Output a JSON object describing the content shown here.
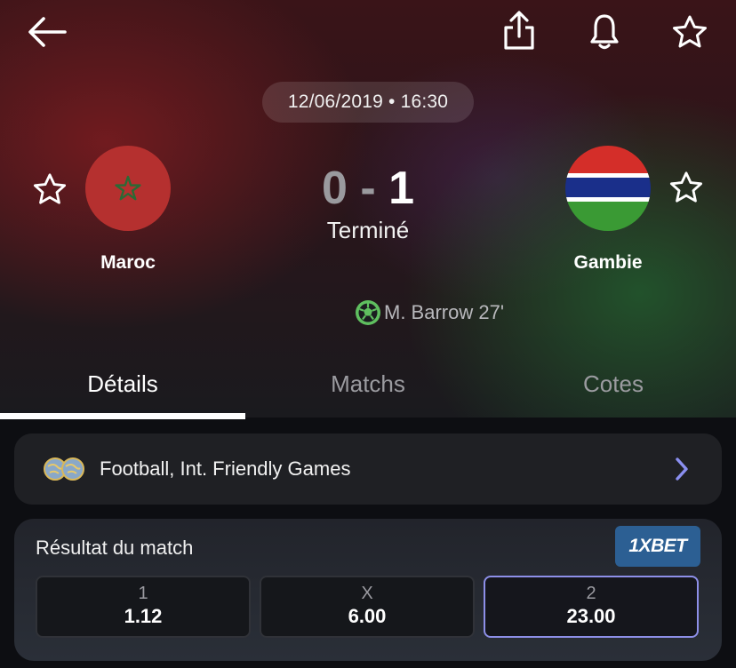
{
  "header": {
    "icons": [
      "arrow-left-icon",
      "share-icon",
      "bell-icon",
      "star-icon"
    ]
  },
  "match": {
    "datetime": "12/06/2019 • 16:30",
    "home": {
      "name": "Maroc",
      "flag": "morocco-flag",
      "flag_color": "#b5302f"
    },
    "away": {
      "name": "Gambie",
      "flag": "gambia-flag",
      "flag_colors": [
        "#d42e29",
        "#ffffff",
        "#1a2f8a",
        "#3a9a34"
      ]
    },
    "score_home": "0",
    "score_sep": "-",
    "score_away": "1",
    "status": "Terminé",
    "goals": [
      {
        "player": "M. Barrow 27'",
        "icon": "football-icon",
        "icon_color": "#5fbf5f"
      }
    ]
  },
  "tabs": [
    {
      "label": "Détails",
      "active": true
    },
    {
      "label": "Matchs",
      "active": false
    },
    {
      "label": "Cotes",
      "active": false
    }
  ],
  "league": {
    "name": "Football, Int. Friendly Games",
    "icon": "globe-icon",
    "chevron_color": "#8a8ff0"
  },
  "odds": {
    "title": "Résultat du match",
    "bookmaker": "1XBET",
    "bookmaker_color": "#2c5f93",
    "options": [
      {
        "label": "1",
        "value": "1.12",
        "selected": false
      },
      {
        "label": "X",
        "value": "6.00",
        "selected": false
      },
      {
        "label": "2",
        "value": "23.00",
        "selected": true
      }
    ]
  }
}
